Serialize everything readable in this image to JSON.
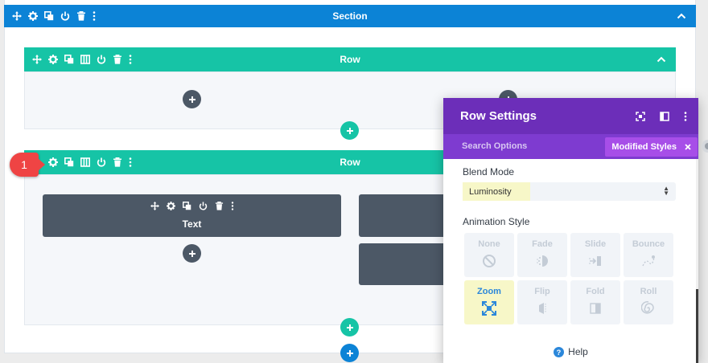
{
  "section": {
    "title": "Section",
    "color": "#0c83d6"
  },
  "rows": [
    {
      "title": "Row",
      "color": "#16c4a6"
    },
    {
      "title": "Row",
      "color": "#16c4a6"
    }
  ],
  "modules": [
    {
      "title": "Text"
    }
  ],
  "step_badge": {
    "number": "1",
    "color": "#ef4444"
  },
  "panel": {
    "title": "Row Settings",
    "search_placeholder": "Search Options",
    "modified_label": "Modified Styles",
    "blend_mode": {
      "label": "Blend Mode",
      "value": "Luminosity"
    },
    "animation": {
      "label": "Animation Style",
      "options": [
        {
          "label": "None",
          "icon": "none-icon"
        },
        {
          "label": "Fade",
          "icon": "fade-icon"
        },
        {
          "label": "Slide",
          "icon": "slide-icon"
        },
        {
          "label": "Bounce",
          "icon": "bounce-icon"
        },
        {
          "label": "Zoom",
          "icon": "zoom-icon",
          "selected": true
        },
        {
          "label": "Flip",
          "icon": "flip-icon"
        },
        {
          "label": "Fold",
          "icon": "fold-icon"
        },
        {
          "label": "Roll",
          "icon": "roll-icon"
        }
      ]
    },
    "help_label": "Help",
    "header_color": "#6c2eb9",
    "highlight_color": "#f7f7c8"
  }
}
